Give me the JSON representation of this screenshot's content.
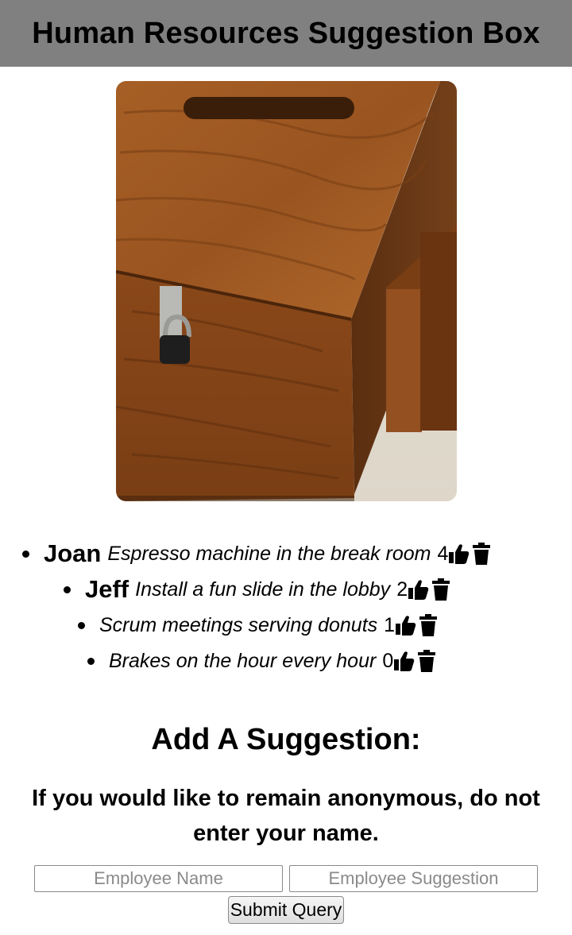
{
  "header": {
    "title": "Human Resources Suggestion Box"
  },
  "photo": {
    "subject": "wooden suggestion box with padlock"
  },
  "suggestions": [
    {
      "name": "Joan",
      "text": "Espresso machine in the break room",
      "votes": "4"
    },
    {
      "name": "Jeff",
      "text": "Install a fun slide in the lobby",
      "votes": "2"
    },
    {
      "name": "",
      "text": "Scrum meetings serving donuts",
      "votes": "1"
    },
    {
      "name": "",
      "text": "Brakes on the hour every hour",
      "votes": "0"
    }
  ],
  "icons": {
    "like": "thumbs-up-icon",
    "delete": "trash-icon"
  },
  "form": {
    "title": "Add A Suggestion:",
    "note": "If you would like to remain anonymous, do not enter your name.",
    "name_placeholder": "Employee Name",
    "suggestion_placeholder": "Employee Suggestion",
    "name_value": "",
    "suggestion_value": "",
    "submit_label": "Submit Query"
  },
  "colors": {
    "header_bg": "#808080",
    "wood": "#8a4a1c",
    "text": "#000000"
  }
}
